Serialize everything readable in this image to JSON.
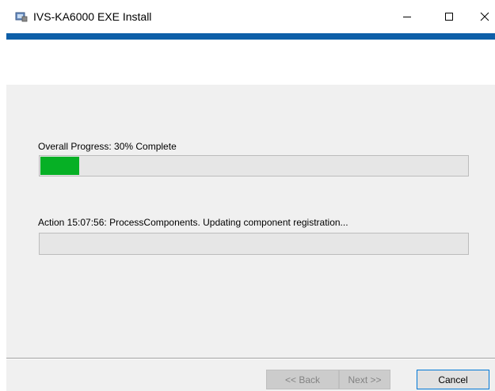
{
  "window": {
    "title": "IVS-KA6000 EXE Install",
    "icon": "installer-icon",
    "controls": {
      "minimize": "minimize-icon",
      "maximize": "maximize-icon",
      "close": "close-icon"
    }
  },
  "colors": {
    "accent": "#0e5fa8",
    "progress_fill": "#06b025",
    "background": "#f0f0f0"
  },
  "progress": {
    "label": "Overall Progress: 30% Complete",
    "value": 0.09
  },
  "action": {
    "text": "Action 15:07:56: ProcessComponents. Updating component registration...",
    "value": 0
  },
  "buttons": {
    "back": "<< Back",
    "next": "Next >>",
    "cancel": "Cancel"
  }
}
